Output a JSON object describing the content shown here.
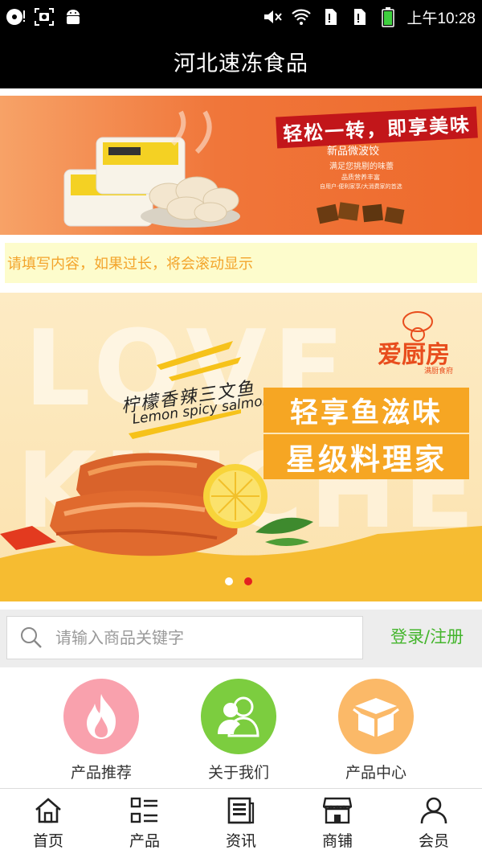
{
  "status_bar": {
    "time": "上午10:28",
    "left_icons": [
      "media-disc-icon",
      "screenshot-icon",
      "android-icon"
    ],
    "right_icons": [
      "mute-icon",
      "wifi-icon",
      "sim1-icon",
      "sim2-icon",
      "battery-icon"
    ]
  },
  "header": {
    "title": "河北速冻食品"
  },
  "banner_top": {
    "slogan": "轻松一转，即享美味",
    "product": "新品微波饺",
    "line1": "满足您挑剔的味蕾",
    "line2": "品质营养丰富",
    "line3": "自用户·便利家享/大消费家的首选"
  },
  "notice": {
    "text": "请填写内容，如果过长，将会滚动显示"
  },
  "banner_main": {
    "bg_text_1": "LOVE",
    "bg_text_2": "KITCHEN",
    "brand": "爱厨房",
    "brand_sub": "满厨食府",
    "product_cn": "柠檬香辣三文鱼",
    "product_en": "Lemon spicy salmon",
    "headline1": "轻享鱼滋味",
    "headline2": "星级料理家",
    "active_slide": 2,
    "slide_count": 2
  },
  "search": {
    "placeholder": "请输入商品关键字"
  },
  "login": {
    "label": "登录/注册"
  },
  "categories": [
    {
      "label": "产品推荐",
      "icon": "flame-icon",
      "color": "#f9a1ad"
    },
    {
      "label": "关于我们",
      "icon": "users-icon",
      "color": "#7ccd3f"
    },
    {
      "label": "产品中心",
      "icon": "box-icon",
      "color": "#fbb968"
    }
  ],
  "bottom_nav": [
    {
      "label": "首页",
      "icon": "home-icon"
    },
    {
      "label": "产品",
      "icon": "list-icon"
    },
    {
      "label": "资讯",
      "icon": "news-icon"
    },
    {
      "label": "商铺",
      "icon": "store-icon"
    },
    {
      "label": "会员",
      "icon": "user-icon"
    }
  ],
  "colors": {
    "header_bg": "#000000",
    "notice_bg": "#fdfccc",
    "notice_text": "#f3a42b",
    "login_green": "#44b52c",
    "dot_active": "#e32020",
    "dot_inactive": "#ffffff"
  }
}
